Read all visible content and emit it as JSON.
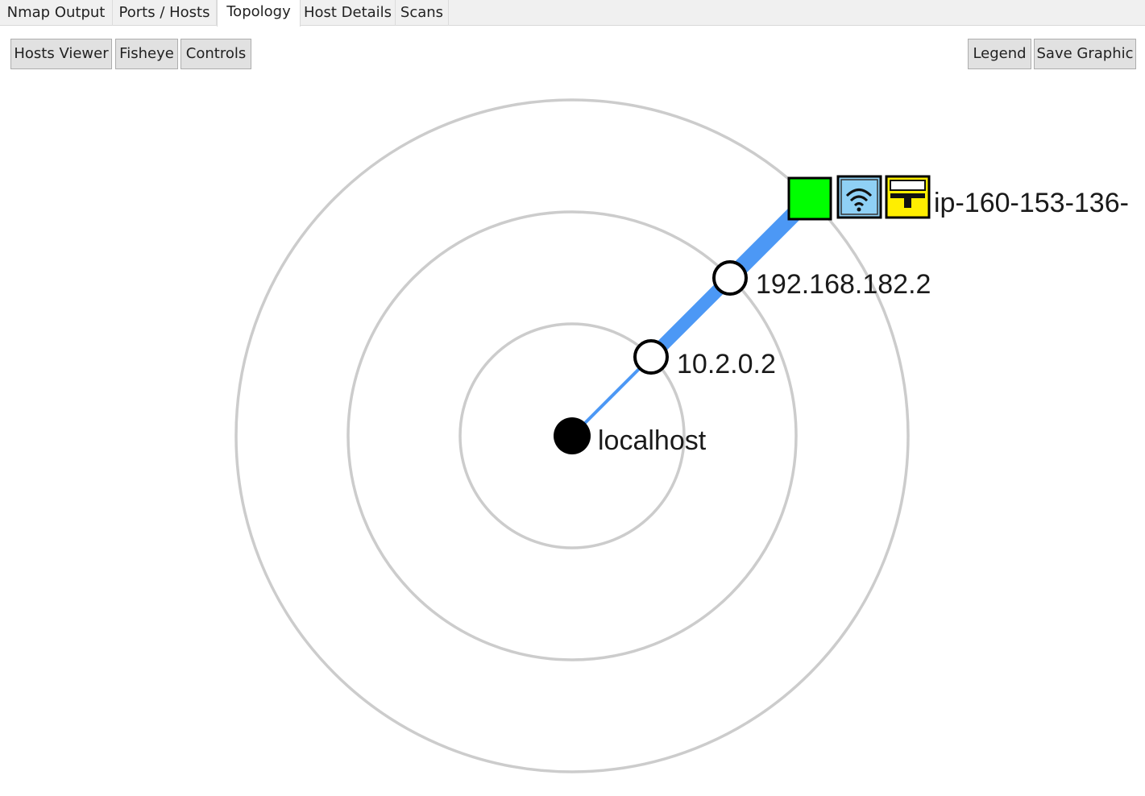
{
  "tabs": [
    {
      "label": "Nmap Output",
      "active": false
    },
    {
      "label": "Ports / Hosts",
      "active": false
    },
    {
      "label": "Topology",
      "active": true
    },
    {
      "label": "Host Details",
      "active": false
    },
    {
      "label": "Scans",
      "active": false
    }
  ],
  "toolbar": {
    "hosts_viewer": "Hosts Viewer",
    "fisheye": "Fisheye",
    "controls": "Controls",
    "legend": "Legend",
    "save_graphic": "Save Graphic"
  },
  "topology": {
    "ring_color": "#cccccc",
    "link_color": "#4c98f5",
    "nodes": [
      {
        "label": "localhost",
        "type": "local"
      },
      {
        "label": "10.2.0.2",
        "type": "router"
      },
      {
        "label": "192.168.182.2",
        "type": "router"
      },
      {
        "label": "ip-160-153-136-",
        "type": "host"
      }
    ],
    "host_icons": [
      {
        "name": "green-status-icon",
        "color": "#00ff00"
      },
      {
        "name": "wireless-icon",
        "color": "#8fd0f5"
      },
      {
        "name": "firewall-icon",
        "color": "#ffee00"
      }
    ]
  }
}
